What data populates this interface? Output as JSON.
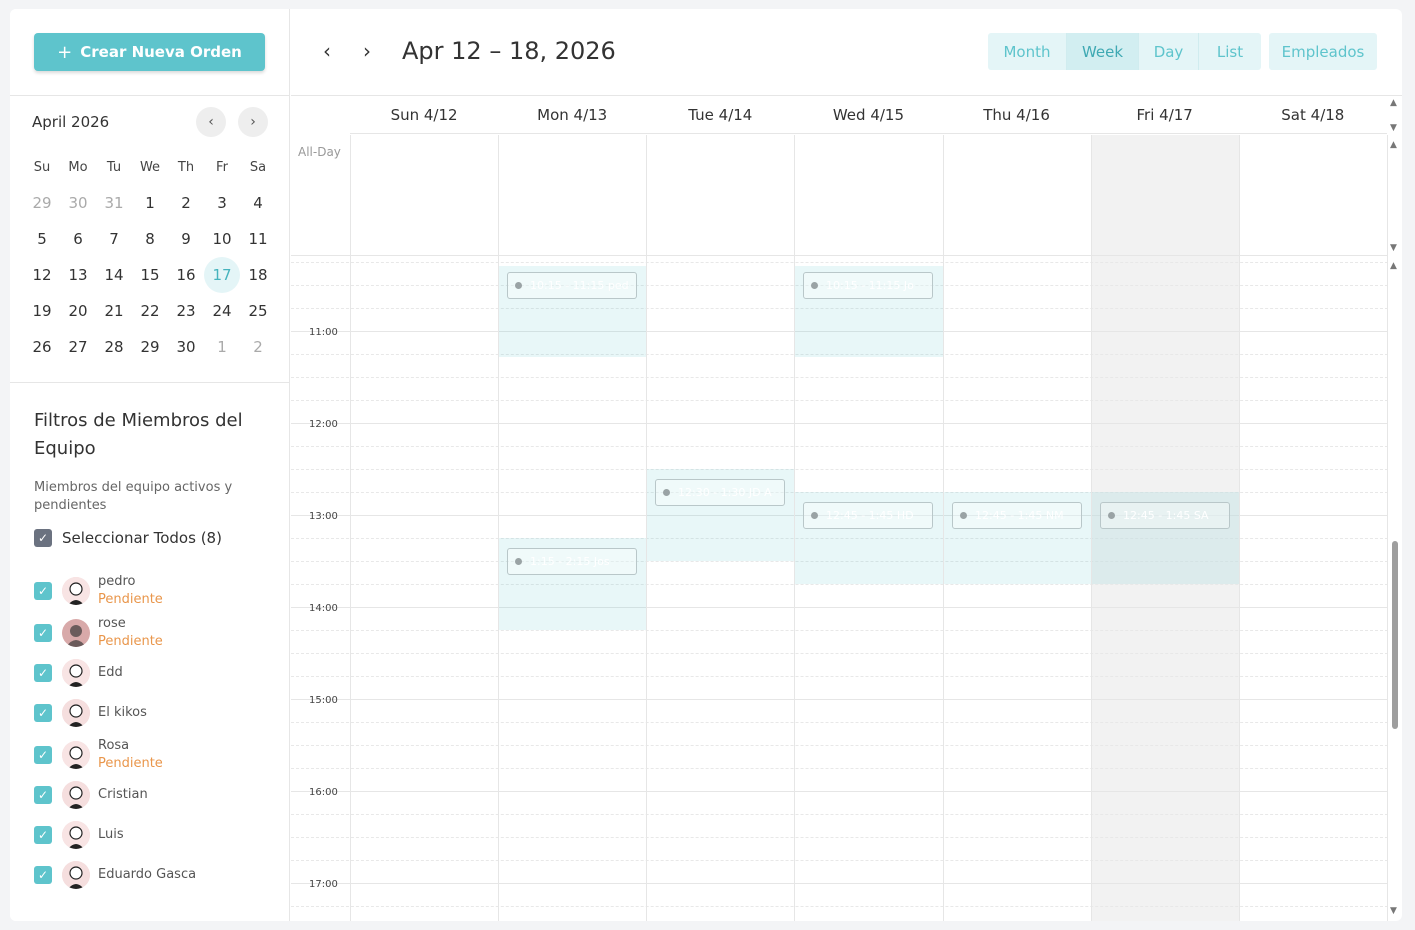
{
  "sidebar": {
    "new_order_label": "Crear Nueva Orden",
    "mini_calendar": {
      "title": "April 2026",
      "dow": [
        "Su",
        "Mo",
        "Tu",
        "We",
        "Th",
        "Fr",
        "Sa"
      ],
      "weeks": [
        [
          "29",
          "30",
          "31",
          "1",
          "2",
          "3",
          "4"
        ],
        [
          "5",
          "6",
          "7",
          "8",
          "9",
          "10",
          "11"
        ],
        [
          "12",
          "13",
          "14",
          "15",
          "16",
          "17",
          "18"
        ],
        [
          "19",
          "20",
          "21",
          "22",
          "23",
          "24",
          "25"
        ],
        [
          "26",
          "27",
          "28",
          "29",
          "30",
          "1",
          "2"
        ]
      ],
      "today": "17"
    },
    "filters_title": "Filtros de Miembros del Equipo",
    "filters_subtitle": "Miembros del equipo activos y pendientes",
    "select_all_label": "Seleccionar Todos (8)",
    "members": [
      {
        "name": "pedro",
        "status": "Pendiente"
      },
      {
        "name": "rose",
        "status": "Pendiente"
      },
      {
        "name": "Edd",
        "status": ""
      },
      {
        "name": "El kikos",
        "status": ""
      },
      {
        "name": "Rosa",
        "status": "Pendiente"
      },
      {
        "name": "Cristian",
        "status": ""
      },
      {
        "name": "Luis",
        "status": ""
      },
      {
        "name": "Eduardo Gasca",
        "status": ""
      }
    ]
  },
  "toolbar": {
    "prev_icon": "chevron-left-icon",
    "next_icon": "chevron-right-icon",
    "range_title": "Apr 12 – 18, 2026",
    "views": [
      "Month",
      "Week",
      "Day",
      "List"
    ],
    "active_view": "Week",
    "employees_label": "Empleados"
  },
  "calendar": {
    "day_headers": [
      "Sun 4/12",
      "Mon 4/13",
      "Tue 4/14",
      "Wed 4/15",
      "Thu 4/16",
      "Fri 4/17",
      "Sat 4/18"
    ],
    "all_day_label": "All-Day",
    "time_labels": [
      "11:00",
      "12:00",
      "13:00",
      "14:00",
      "15:00",
      "16:00",
      "17:00"
    ],
    "events": [
      {
        "label": "10:15 - 11:15 ped"
      },
      {
        "label": "10:15 - 11:15 Jo"
      },
      {
        "label": "12:30 - 1:30 JD A"
      },
      {
        "label": "12:45 - 1:45 HD"
      },
      {
        "label": "12:45 - 1:45 NM"
      },
      {
        "label": "12:45 - 1:45 SA"
      },
      {
        "label": "1:15 - 2:15 Jos"
      }
    ]
  },
  "colors": {
    "accent": "#5ec4cc",
    "pending": "#e9964b"
  }
}
